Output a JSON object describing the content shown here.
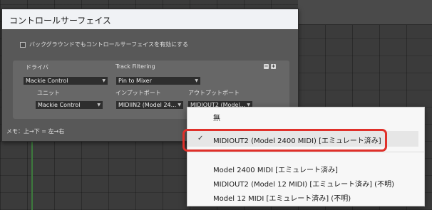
{
  "dialog": {
    "title": "コントロールサーフェイス",
    "background_option": "バックグラウンドでもコントロールサーフェイスを有効にする",
    "driver_label": "ドライバ",
    "track_filtering_label": "Track Filtering",
    "driver_value": "Mackie Control",
    "track_filtering_value": "Pin to Mixer",
    "unit_label": "ユニット",
    "input_port_label": "インプットポート",
    "output_port_label": "アウトプットポート",
    "unit_value": "Mackie Control",
    "input_port_value": "MIDIIN2 (Model 24...",
    "output_port_value": "MIDIOUT2 (Model...",
    "remove_icon": "minus-icon",
    "add_icon": "plus-icon",
    "memo": "メモ：上→下 = 左→右"
  },
  "menu": {
    "items": [
      {
        "label": "無",
        "checked": false
      },
      {
        "label": "MIDIOUT2 (Model 2400 MIDI) [エミュレート済み]",
        "checked": true
      },
      {
        "label": "Model 2400 MIDI [エミュレート済み]",
        "checked": false
      },
      {
        "label": "MIDIOUT2 (Model 12 MIDI) [エミュレート済み] (不明)",
        "checked": false
      },
      {
        "label": "Model 12 MIDI [エミュレート済み] (不明)",
        "checked": false
      }
    ],
    "check_mark": "✓",
    "highlight_color": "#e0302a"
  }
}
